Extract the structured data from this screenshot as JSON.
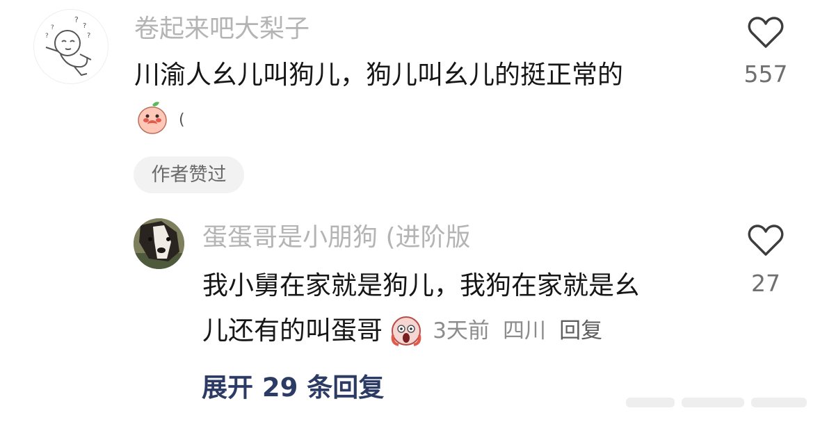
{
  "comment": {
    "username": "卷起来吧大梨子",
    "text": "川渝人幺儿叫狗儿，狗儿叫幺儿的挺正常的",
    "trailing_mark": "(",
    "like_count": "557",
    "badge": "作者赞过"
  },
  "reply": {
    "username": "蛋蛋哥是小朋狗 (进阶版",
    "text_line1": "我小舅在家就是狗儿，我狗在家就是幺",
    "text_line2": "儿还有的叫蛋哥",
    "time": "3天前",
    "location": "四川",
    "reply_label": "回复",
    "like_count": "27"
  },
  "expand_label": "展开 29 条回复",
  "colors": {
    "username": "#b4b4b4",
    "body_text": "#161616",
    "link": "#2c3b63",
    "badge_bg": "#f2f2f2",
    "count": "#6f6f6f"
  },
  "icons": [
    "avatar-cartoon-baby",
    "heart-outline-icon",
    "peach-shy-emoji",
    "scream-emoji",
    "avatar-dog-photo"
  ]
}
